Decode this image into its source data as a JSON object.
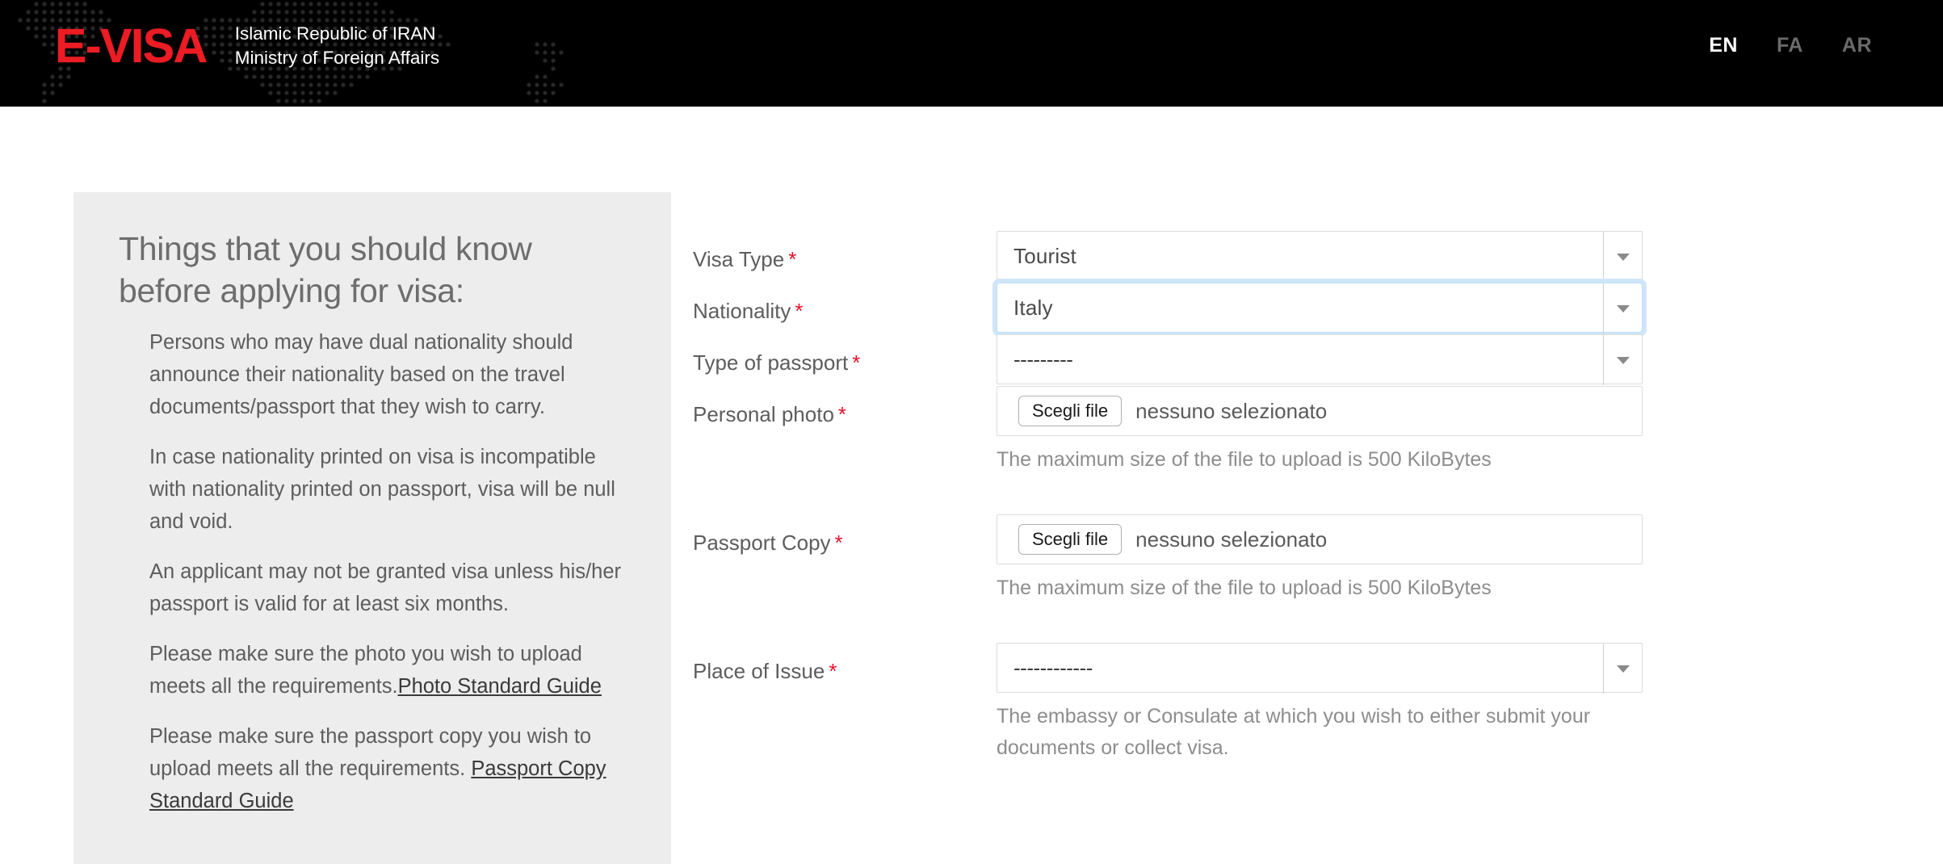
{
  "header": {
    "logo_text": "E-VISA",
    "title_line1": "Islamic Republic of IRAN",
    "title_line2": "Ministry of Foreign Affairs",
    "languages": [
      {
        "code": "EN",
        "active": true
      },
      {
        "code": "FA",
        "active": false
      },
      {
        "code": "AR",
        "active": false
      }
    ],
    "background_color": "#000000",
    "logo_color": "#ec1c24"
  },
  "info_panel": {
    "title": "Things that you should know before applying for visa:",
    "items": [
      {
        "text": "Persons who may have dual nationality should announce their nationality based on the travel documents/passport that they wish to carry.",
        "link": ""
      },
      {
        "text": "In case nationality printed on visa is incompatible with nationality printed on passport, visa will be null and void.",
        "link": ""
      },
      {
        "text": "An applicant may not be granted visa unless his/her passport is valid for at least six months.",
        "link": ""
      },
      {
        "text": "Please make sure the photo you wish to upload meets all the requirements.",
        "link": "Photo Standard Guide"
      },
      {
        "text": "Please make sure the passport copy you wish to upload meets all the requirements. ",
        "link": "Passport Copy Standard Guide"
      }
    ],
    "background_color": "#ededed"
  },
  "form": {
    "required_marker": "*",
    "fields": [
      {
        "id": "visa-type",
        "label": "Visa Type",
        "required": true,
        "kind": "select",
        "value": "Tourist",
        "focused": false,
        "help": ""
      },
      {
        "id": "nationality",
        "label": "Nationality",
        "required": true,
        "kind": "select",
        "value": "Italy",
        "focused": true,
        "help": ""
      },
      {
        "id": "type-of-passport",
        "label": "Type of passport",
        "required": true,
        "kind": "select",
        "value": "---------",
        "focused": false,
        "help": ""
      },
      {
        "id": "personal-photo",
        "label": "Personal photo",
        "required": true,
        "kind": "file",
        "button_label": "Scegli file",
        "file_status": "nessuno selezionato",
        "focused": false,
        "help": "The maximum size of the file to upload is 500 KiloBytes"
      },
      {
        "id": "passport-copy",
        "label": "Passport Copy",
        "required": true,
        "kind": "file",
        "button_label": "Scegli file",
        "file_status": "nessuno selezionato",
        "focused": false,
        "help": "The maximum size of the file to upload is 500 KiloBytes"
      },
      {
        "id": "place-of-issue",
        "label": "Place of Issue",
        "required": true,
        "kind": "select",
        "value": "------------",
        "focused": false,
        "help": "The embassy or Consulate at which you wish to either submit your documents or collect visa."
      }
    ],
    "icons": {
      "dropdown": "chevron-down-icon"
    },
    "colors": {
      "required": "#e8112d",
      "focus_ring": "#cfe6f8",
      "label": "#5d5d5d",
      "help": "#8d8d8d"
    }
  }
}
